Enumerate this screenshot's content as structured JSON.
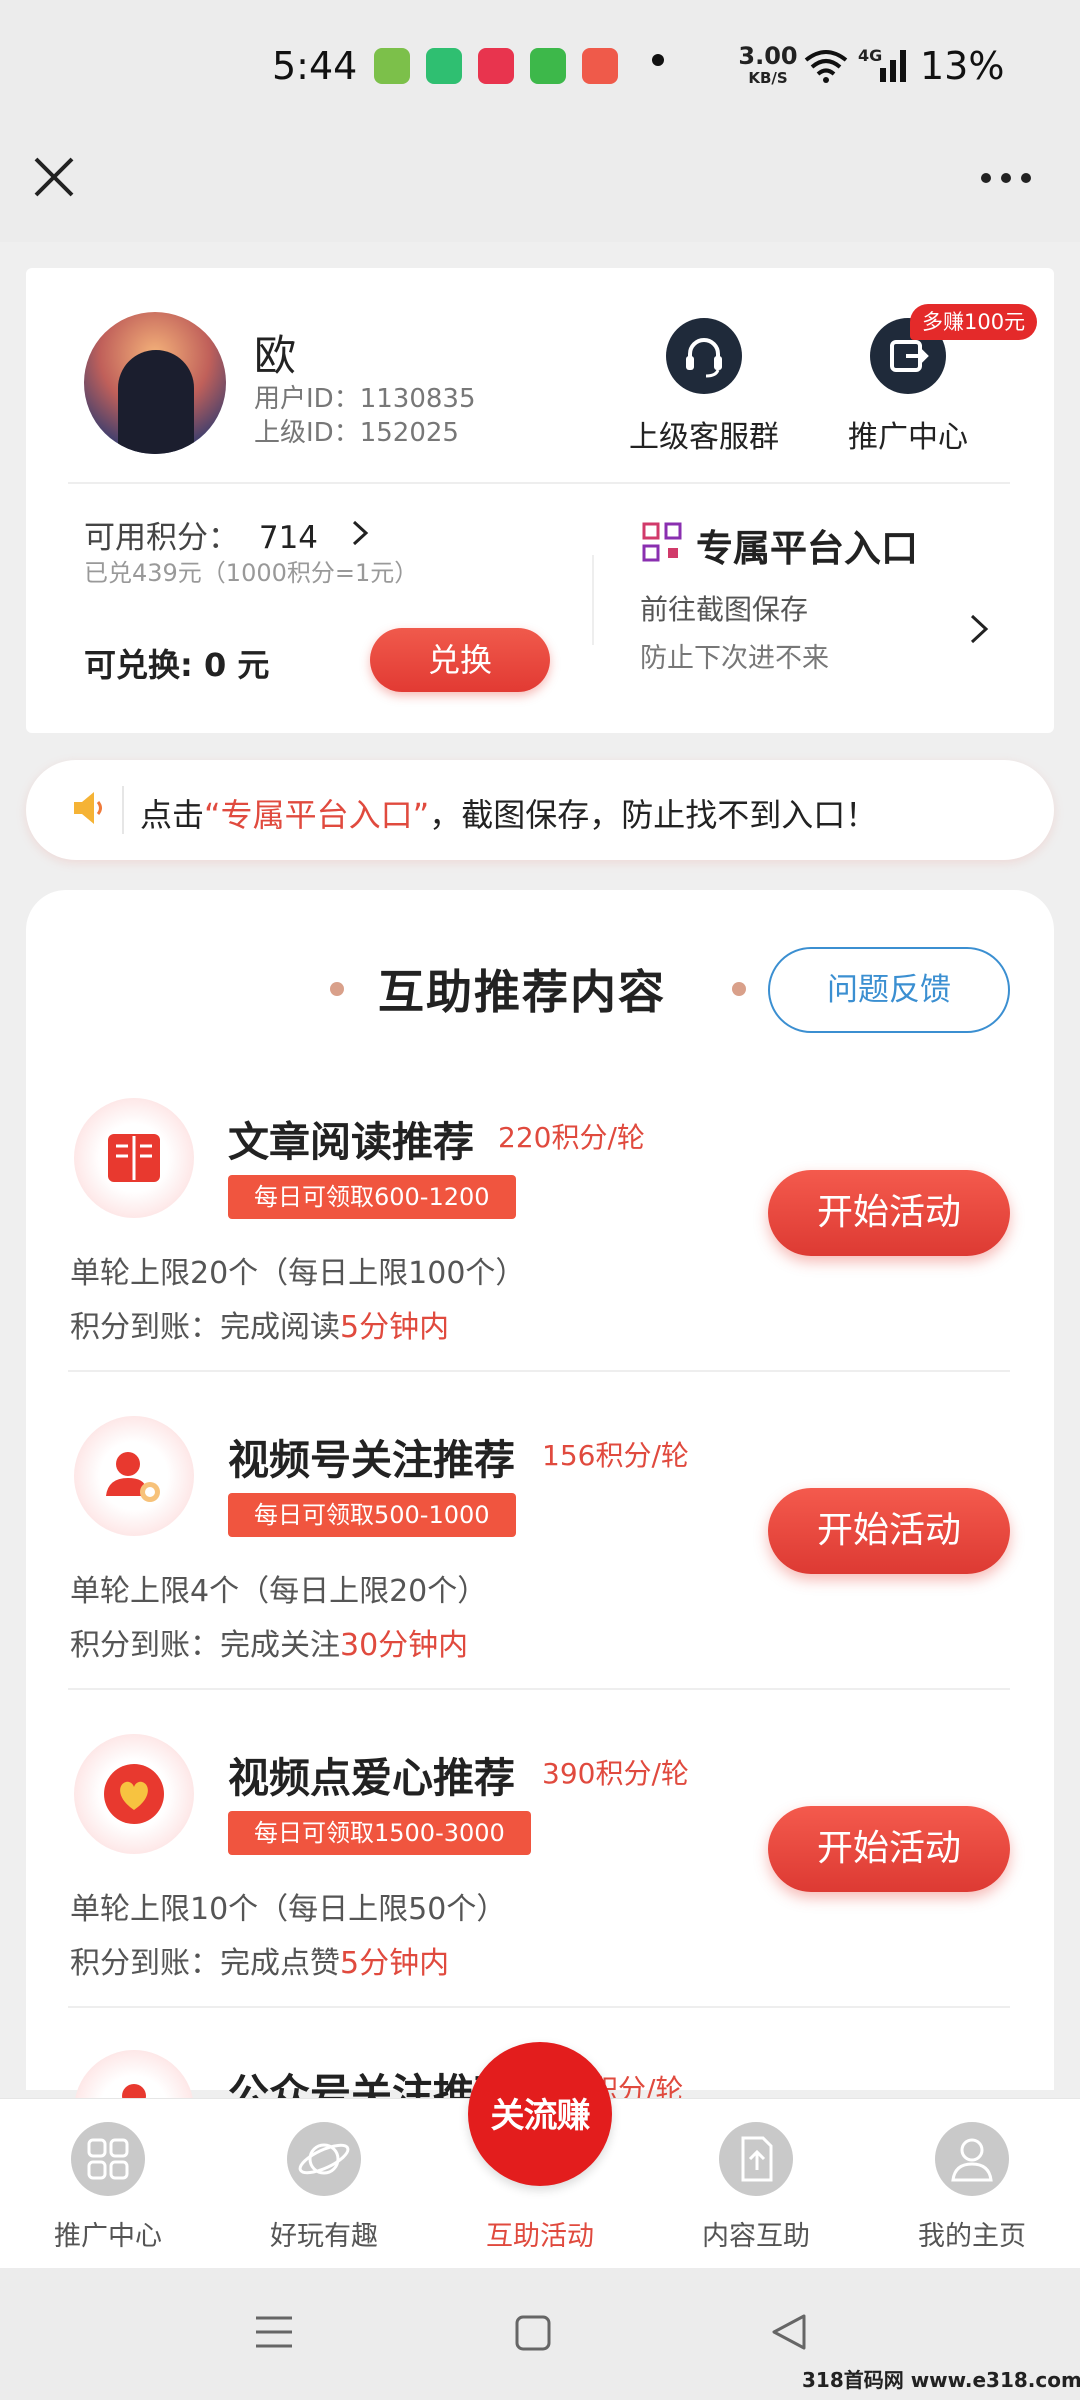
{
  "status_bar": {
    "time": "5:44",
    "net_speed_value": "3.00",
    "net_speed_unit": "KB/S",
    "network": "4G",
    "battery": "13%"
  },
  "profile": {
    "name": "欧",
    "user_id": "用户ID：1130835",
    "parent_id": "上级ID：152025"
  },
  "quick_actions": [
    {
      "label": "上级客服群",
      "icon": "headset-icon"
    },
    {
      "label": "推广中心",
      "icon": "share-exit-icon",
      "tag": "多赚100元"
    }
  ],
  "points": {
    "label": "可用积分：",
    "value": "714",
    "redeemed": "已兑439元（1000积分=1元）",
    "exchangeable": "可兑换: 0 元",
    "exchange_button": "兑换"
  },
  "portal": {
    "title": "专属平台入口",
    "sub1": "前往截图保存",
    "sub2": "防止下次进不来"
  },
  "notice": {
    "prefix": "点击",
    "highlight": "“专属平台入口”",
    "suffix": "，截图保存，防止找不到入口！"
  },
  "section": {
    "title": "互助推荐内容",
    "feedback_button": "问题反馈"
  },
  "tasks": [
    {
      "title": "文章阅读推荐",
      "rate": "220积分/轮",
      "badge": "每日可领取600-1200",
      "limit": "单轮上限20个（每日上限100个）",
      "credit_prefix": "积分到账：完成阅读",
      "credit_time": "5分钟内",
      "button": "开始活动",
      "icon": "book-icon"
    },
    {
      "title": "视频号关注推荐",
      "rate": "156积分/轮",
      "badge": "每日可领取500-1000",
      "limit": "单轮上限4个（每日上限20个）",
      "credit_prefix": "积分到账：完成关注",
      "credit_time": "30分钟内",
      "button": "开始活动",
      "icon": "user-follow-icon"
    },
    {
      "title": "视频点爱心推荐",
      "rate": "390积分/轮",
      "badge": "每日可领取1500-3000",
      "limit": "单轮上限10个（每日上限50个）",
      "credit_prefix": "积分到账：完成点赞",
      "credit_time": "5分钟内",
      "button": "开始活动",
      "icon": "heart-icon"
    },
    {
      "title": "公众号关注推荐",
      "rate": "积分/轮",
      "icon": "user-icon"
    }
  ],
  "bottom_nav": [
    {
      "label": "推广中心",
      "icon": "grid-icon",
      "active": false
    },
    {
      "label": "好玩有趣",
      "icon": "planet-icon",
      "active": false
    },
    {
      "label": "互助活动",
      "icon": "logo-icon",
      "active": true
    },
    {
      "label": "内容互助",
      "icon": "upload-doc-icon",
      "active": false
    },
    {
      "label": "我的主页",
      "icon": "person-icon",
      "active": false
    }
  ],
  "center_logo_text": "关流赚",
  "watermark": "318首码网 www.e318.com",
  "colors": {
    "accent": "#e04a3e",
    "button": "#e23a33",
    "feedback": "#3b8fd1",
    "dark_icon": "#1f2a3a"
  }
}
